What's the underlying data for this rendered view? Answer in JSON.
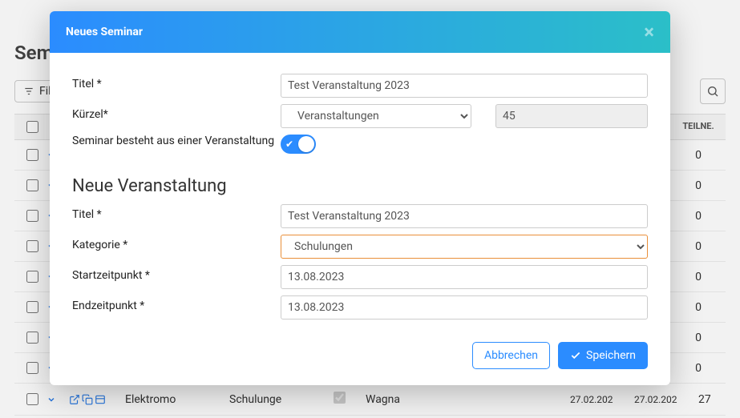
{
  "page": {
    "title_partial": "Sem",
    "filter_label": "Fil"
  },
  "table": {
    "head": {
      "col_teilne": "LNE…",
      "col_teilne2": "TEILNE."
    },
    "participant_counts": [
      0,
      0,
      0,
      0,
      0,
      0,
      0,
      0
    ],
    "last_row": {
      "title": "Elektromo",
      "category": "Schulunge",
      "location": "Wagna",
      "date1": "27.02.202",
      "date2": "27.02.202",
      "count": "27"
    }
  },
  "modal": {
    "title": "Neues Seminar",
    "labels": {
      "titel": "Titel *",
      "kurzel": "Kürzel*",
      "single_event": "Seminar besteht aus einer Veranstaltung",
      "section": "Neue Veranstaltung",
      "kategorie": "Kategorie *",
      "start": "Startzeitpunkt *",
      "end": "Endzeitpunkt *"
    },
    "values": {
      "titel": "Test Veranstaltung 2023",
      "kurzel_select": "Veranstaltungen",
      "kurzel_num": "45",
      "event_titel": "Test Veranstaltung 2023",
      "kategorie": "Schulungen",
      "start": "13.08.2023",
      "end": "13.08.2023"
    },
    "buttons": {
      "cancel": "Abbrechen",
      "save": "Speichern"
    }
  }
}
